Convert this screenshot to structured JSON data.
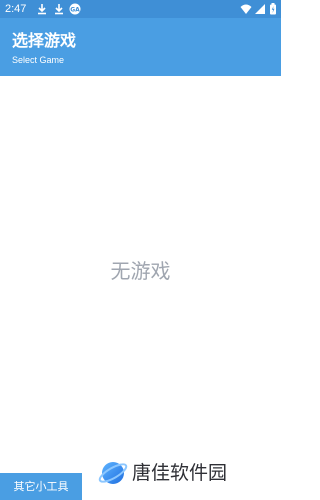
{
  "status_bar": {
    "time": "2:47",
    "icons": [
      "download-icon",
      "download-icon",
      "circle-badge-icon",
      "wifi-icon",
      "signal-icon",
      "battery-icon"
    ],
    "badge_text": "GA"
  },
  "app_bar": {
    "title": "选择游戏",
    "subtitle": "Select Game"
  },
  "main": {
    "empty_text": "无游戏"
  },
  "bottom": {
    "other_tools_label": "其它小工具"
  },
  "watermark": {
    "text": "唐佳软件园"
  },
  "colors": {
    "status_bar": "#3f8fd6",
    "app_bar": "#4a9ee3",
    "empty_text": "#a0a6b0",
    "watermark_text": "#2f3036"
  }
}
